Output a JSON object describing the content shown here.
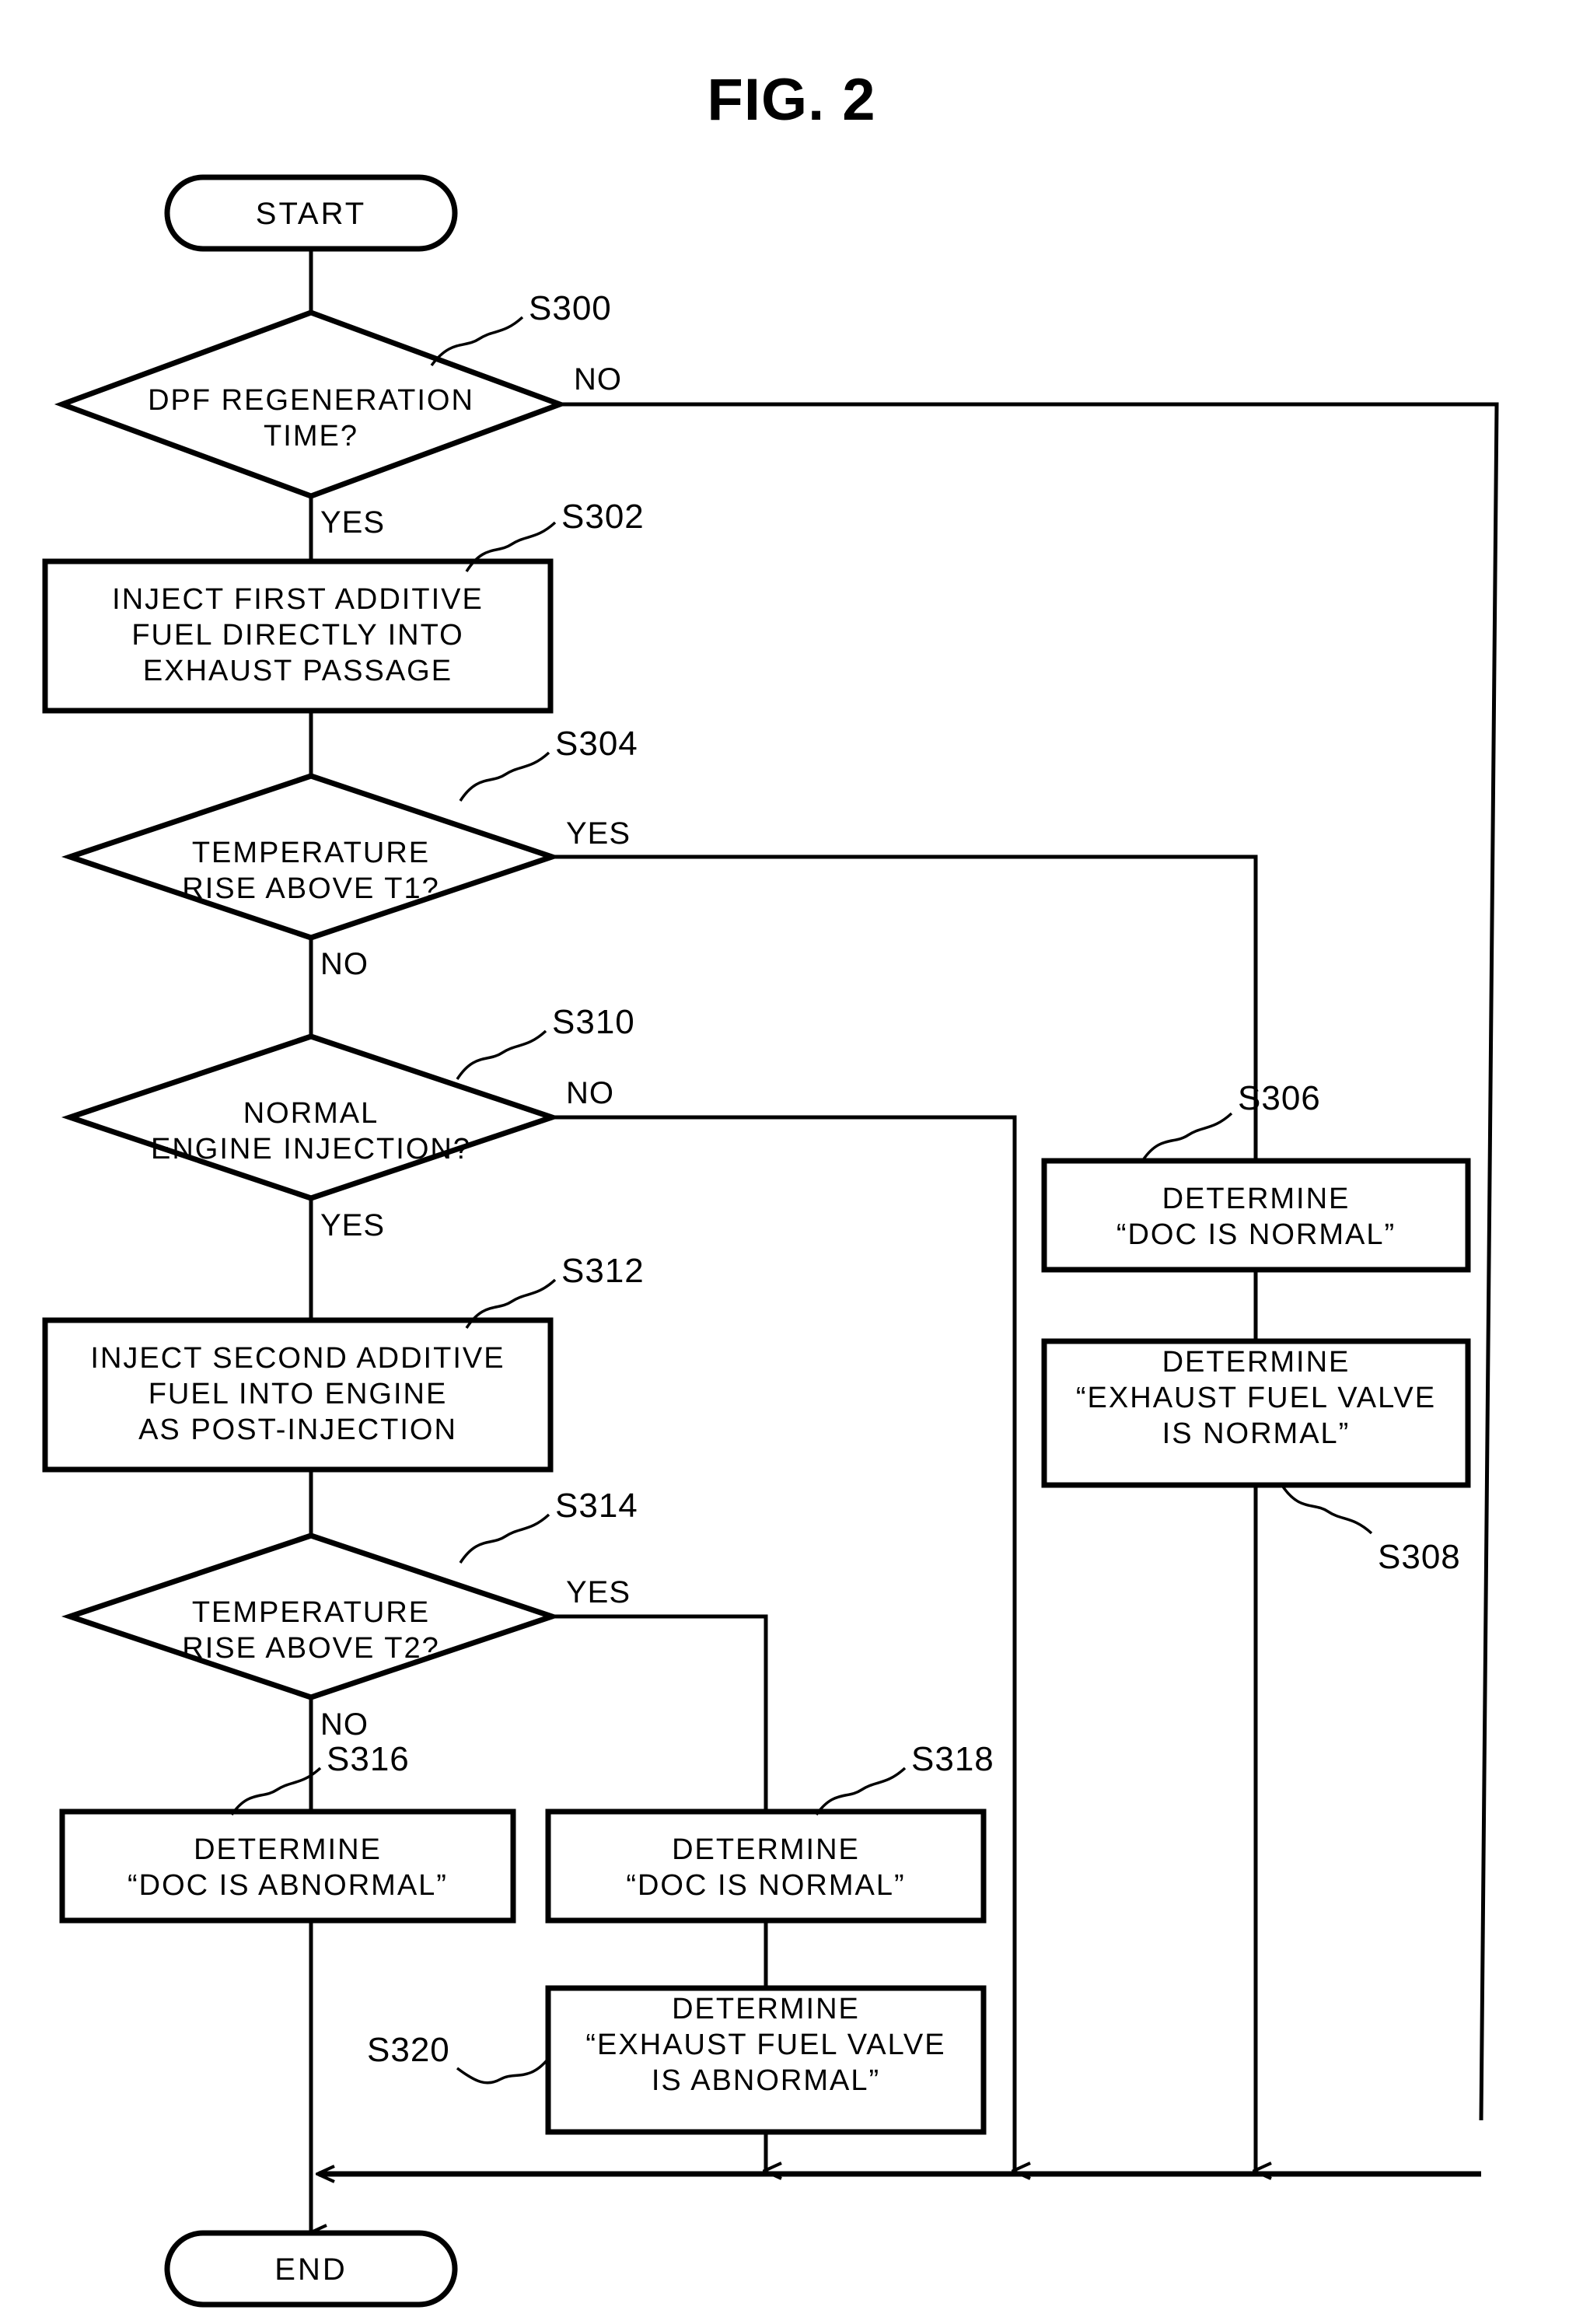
{
  "figure": {
    "title": "FIG. 2"
  },
  "nodes": {
    "start": {
      "label": "START"
    },
    "end": {
      "label": "END"
    },
    "s300": {
      "text": "DPF REGENERATION\nTIME?",
      "step": "S300"
    },
    "s302": {
      "text": "INJECT FIRST ADDITIVE\nFUEL DIRECTLY INTO\nEXHAUST PASSAGE",
      "step": "S302"
    },
    "s304": {
      "text": "TEMPERATURE\nRISE ABOVE T1?",
      "step": "S304"
    },
    "s306": {
      "text": "DETERMINE\n“DOC IS NORMAL”",
      "step": "S306"
    },
    "s308": {
      "text": "DETERMINE\n“EXHAUST FUEL VALVE\nIS NORMAL”",
      "step": "S308"
    },
    "s310": {
      "text": "NORMAL\nENGINE INJECTION?",
      "step": "S310"
    },
    "s312": {
      "text": "INJECT SECOND ADDITIVE\nFUEL INTO ENGINE\nAS POST-INJECTION",
      "step": "S312"
    },
    "s314": {
      "text": "TEMPERATURE\nRISE ABOVE T2?",
      "step": "S314"
    },
    "s316": {
      "text": "DETERMINE\n“DOC IS ABNORMAL”",
      "step": "S316"
    },
    "s318": {
      "text": "DETERMINE\n“DOC IS NORMAL”",
      "step": "S318"
    },
    "s320": {
      "text": "DETERMINE\n“EXHAUST FUEL VALVE\nIS ABNORMAL”",
      "step": "S320"
    }
  },
  "branches": {
    "s300_no": "NO",
    "s300_yes": "YES",
    "s304_yes": "YES",
    "s304_no": "NO",
    "s310_no": "NO",
    "s310_yes": "YES",
    "s314_yes": "YES",
    "s314_no": "NO"
  },
  "colors": {
    "stroke": "#000000",
    "background": "#ffffff"
  }
}
